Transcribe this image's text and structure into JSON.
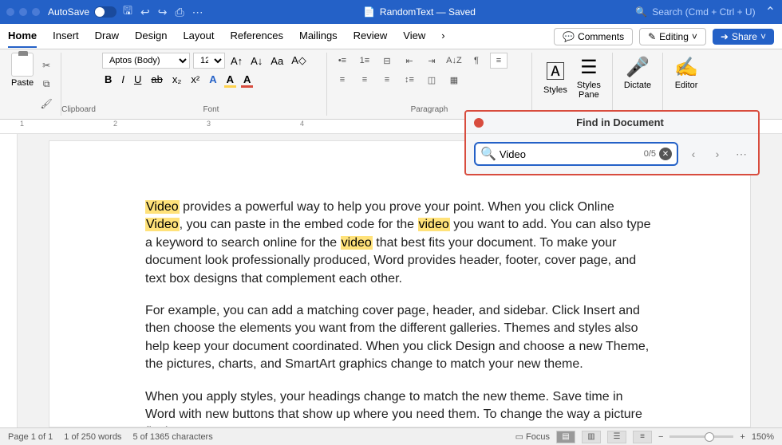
{
  "titlebar": {
    "autosave_label": "AutoSave",
    "doc_title": "RandomText — Saved",
    "search_placeholder": "Search (Cmd + Ctrl + U)"
  },
  "ribbon_tabs": [
    "Home",
    "Insert",
    "Draw",
    "Design",
    "Layout",
    "References",
    "Mailings",
    "Review",
    "View"
  ],
  "ribbon_right": {
    "comments": "Comments",
    "editing": "Editing",
    "share": "Share"
  },
  "groups": {
    "clipboard": "Clipboard",
    "paste": "Paste",
    "font": "Font",
    "paragraph": "Paragraph",
    "styles": "Styles",
    "styles_pane": "Styles\nPane",
    "dictate": "Dictate",
    "editor": "Editor"
  },
  "font": {
    "name": "Aptos (Body)",
    "size": "12"
  },
  "find": {
    "title": "Find in Document",
    "value": "Video",
    "count": "0/5"
  },
  "document": {
    "para1_parts": [
      "Video",
      " provides a powerful way to help you prove your point. When you click Online ",
      "Video",
      ", you can paste in the embed code for the ",
      "video",
      " you want to add. You can also type a keyword to search online for the ",
      "video",
      " that best fits your document. To make your document look professionally produced, Word provides header, footer, cover page, and text box designs that complement each other."
    ],
    "para2": "For example, you can add a matching cover page, header, and sidebar. Click Insert and then choose the elements you want from the different galleries. Themes and styles also help keep your document coordinated. When you click Design and choose a new Theme, the pictures, charts, and SmartArt graphics change to match your new theme.",
    "para3": "When you apply styles, your headings change to match the new theme. Save time in Word with new buttons that show up where you need them. To change the way a picture fits in"
  },
  "statusbar": {
    "page": "Page 1 of 1",
    "words": "1 of 250 words",
    "chars": "5 of 1365 characters",
    "focus": "Focus",
    "zoom": "150%"
  },
  "ruler_marks": [
    "1",
    "2",
    "3",
    "4"
  ]
}
